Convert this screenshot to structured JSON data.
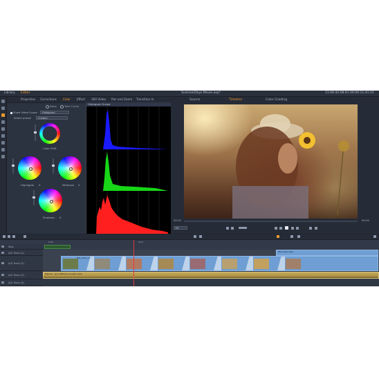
{
  "titlebar": {
    "library": "Library",
    "editor": "Editor",
    "filename": "SummerDays Movie.axp*",
    "timecode": "11:00:42:08.61  00:00:11:41:15"
  },
  "editor": {
    "tabs": [
      {
        "label": "Properties",
        "active": false
      },
      {
        "label": "Corrections",
        "active": false
      },
      {
        "label": "Color",
        "active": true
      },
      {
        "label": "Effect",
        "active": false
      },
      {
        "label": "360 Video",
        "active": false
      },
      {
        "label": "Pan and Zoom",
        "active": false
      },
      {
        "label": "Transition In",
        "active": false
      }
    ],
    "modes": [
      {
        "label": "Basic",
        "selected": false
      },
      {
        "label": "Tone Curve",
        "selected": false
      },
      {
        "label": "HSL Tuning",
        "selected": false
      },
      {
        "label": "Color Wheel",
        "selected": true
      }
    ],
    "show_scope_label": "Show Video Scope",
    "scope_value": "Histogram",
    "preset_label": "Select preset",
    "preset_value": "Custom",
    "color_shift_label": "Color Shift",
    "wheels": [
      {
        "label": "Highlights",
        "value": "0"
      },
      {
        "label": "Midtones",
        "value": "0"
      },
      {
        "label": "Shadows",
        "value": "0"
      }
    ],
    "histogram_title": "Histogram Scope"
  },
  "player": {
    "tabs": [
      {
        "label": "Source",
        "active": false
      },
      {
        "label": "Timeline",
        "active": true
      },
      {
        "label": "Color Grading",
        "active": false
      }
    ],
    "left_time": "00:00",
    "right_time": "00:00",
    "zoom": "Fit"
  },
  "timeline": {
    "tracks": [
      {
        "label": "Solo",
        "kind": "header"
      },
      {
        "label": "A/V Track (1)",
        "kind": "track"
      },
      {
        "label": "A/V Track (2)",
        "kind": "track"
      },
      {
        "label": "A/V Track (3)",
        "kind": "track"
      },
      {
        "label": "A/V Track (4)",
        "kind": "track"
      }
    ],
    "title_clip": "IMG_0001.title",
    "clip_label": "IMG_0001.mov",
    "audio_clip": "Melody - groundBurst acoustic.mp3",
    "ruler_marks": [
      "0:00",
      "0:10"
    ]
  }
}
